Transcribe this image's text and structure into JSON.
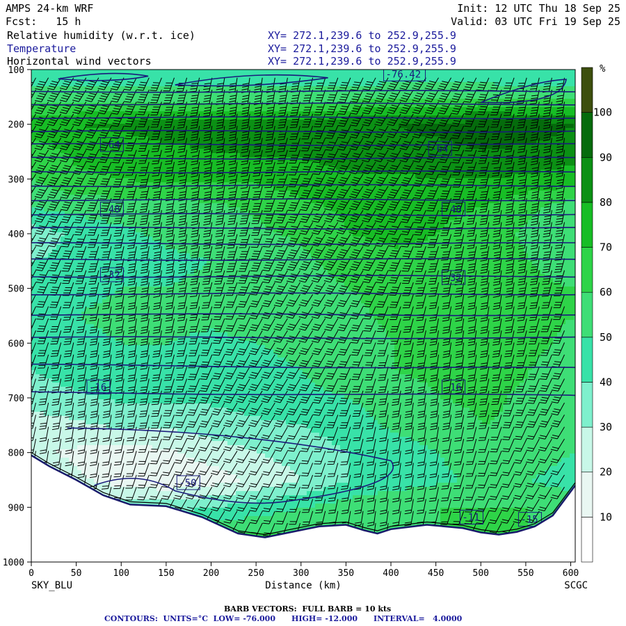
{
  "header": {
    "model": "AMPS 24-km WRF",
    "init": "Init: 12 UTC Thu 18 Sep 25",
    "fcst": "Fcst:   15 h",
    "valid": "Valid: 03 UTC Fri 19 Sep 25",
    "fields": [
      {
        "name": "Relative humidity (w.r.t. ice)",
        "xy": "XY= 272.1,239.6 to 252.9,255.9",
        "color": "#000000"
      },
      {
        "name": "Temperature",
        "xy": "XY= 272.1,239.6 to 252.9,255.9",
        "color": "#1a1a9c"
      },
      {
        "name": "Horizontal wind vectors",
        "xy": "XY= 272.1,239.6 to 252.9,255.9",
        "color": "#000000"
      }
    ]
  },
  "footer": {
    "barb": "BARB VECTORS:  FULL BARB = 10 kts",
    "contours": "CONTOURS:  UNITS=°C  LOW= -76.000      HIGH= -12.000      INTERVAL=   4.0000"
  },
  "chart_data": {
    "type": "heatmap",
    "xlabel": "Distance (km)",
    "x_endpoints": [
      "SKY_BLU",
      "SCGC"
    ],
    "x_ticks": [
      0,
      50,
      100,
      150,
      200,
      250,
      300,
      350,
      400,
      450,
      500,
      550,
      600
    ],
    "xlim": [
      0,
      605
    ],
    "y_ticks": [
      100,
      200,
      300,
      400,
      500,
      600,
      700,
      800,
      900,
      1000
    ],
    "ylim": [
      1000,
      100
    ],
    "colorbar": {
      "unit": "%",
      "ticks": [
        10,
        20,
        30,
        40,
        50,
        60,
        70,
        80,
        90,
        100
      ],
      "colors": [
        "#ffffff",
        "#e9f7f2",
        "#c8f8e8",
        "#7ef0cd",
        "#38e2a8",
        "#3ede76",
        "#2ed448",
        "#17bd25",
        "#0b9014",
        "#056b0c",
        "#3d4f0e"
      ]
    },
    "rh_pattern": {
      "rows": [
        {
          "p": 100,
          "vals": [
            40,
            40,
            40,
            40,
            40,
            40,
            40,
            40,
            40,
            40,
            40,
            40,
            40
          ]
        },
        {
          "p": 150,
          "vals": [
            55,
            55,
            55,
            55,
            55,
            55,
            55,
            55,
            60,
            60,
            60,
            55,
            55
          ]
        },
        {
          "p": 200,
          "vals": [
            75,
            80,
            82,
            85,
            85,
            85,
            85,
            88,
            90,
            92,
            94,
            96,
            90
          ]
        },
        {
          "p": 250,
          "vals": [
            65,
            72,
            75,
            78,
            80,
            82,
            82,
            85,
            88,
            88,
            90,
            88,
            85
          ]
        },
        {
          "p": 300,
          "vals": [
            60,
            68,
            70,
            72,
            72,
            72,
            75,
            78,
            78,
            80,
            80,
            78,
            75
          ]
        },
        {
          "p": 350,
          "vals": [
            50,
            55,
            55,
            55,
            58,
            62,
            68,
            72,
            75,
            72,
            70,
            62,
            55
          ]
        },
        {
          "p": 400,
          "vals": [
            35,
            42,
            48,
            52,
            55,
            58,
            62,
            70,
            72,
            70,
            65,
            58,
            50
          ]
        },
        {
          "p": 450,
          "vals": [
            40,
            42,
            45,
            48,
            50,
            55,
            58,
            65,
            68,
            68,
            65,
            60,
            55
          ]
        },
        {
          "p": 500,
          "vals": [
            45,
            48,
            50,
            50,
            52,
            55,
            55,
            60,
            62,
            65,
            65,
            62,
            60
          ]
        },
        {
          "p": 550,
          "vals": [
            48,
            50,
            52,
            52,
            52,
            55,
            55,
            58,
            62,
            65,
            65,
            62,
            60
          ]
        },
        {
          "p": 600,
          "vals": [
            45,
            48,
            50,
            50,
            48,
            50,
            52,
            55,
            60,
            65,
            65,
            62,
            58
          ]
        },
        {
          "p": 650,
          "vals": [
            40,
            45,
            45,
            45,
            45,
            48,
            50,
            55,
            60,
            62,
            65,
            60,
            55
          ]
        },
        {
          "p": 700,
          "vals": [
            35,
            38,
            42,
            42,
            42,
            45,
            48,
            50,
            55,
            60,
            62,
            58,
            55
          ]
        },
        {
          "p": 750,
          "vals": [
            25,
            28,
            32,
            32,
            35,
            38,
            40,
            45,
            52,
            55,
            60,
            58,
            55
          ]
        },
        {
          "p": 800,
          "vals": [
            22,
            18,
            15,
            18,
            25,
            30,
            35,
            40,
            45,
            50,
            58,
            55,
            50
          ]
        },
        {
          "p": 850,
          "vals": [
            30,
            22,
            15,
            12,
            15,
            22,
            30,
            40,
            45,
            48,
            52,
            50,
            45
          ]
        },
        {
          "p": 900,
          "vals": [
            45,
            40,
            35,
            35,
            40,
            45,
            50,
            55,
            58,
            60,
            60,
            60,
            55
          ]
        },
        {
          "p": 950,
          "vals": [
            60,
            60,
            60,
            60,
            60,
            60,
            60,
            60,
            60,
            60,
            60,
            60,
            60
          ]
        }
      ]
    },
    "terrain_p": [
      [
        0,
        805
      ],
      [
        20,
        825
      ],
      [
        50,
        850
      ],
      [
        80,
        878
      ],
      [
        110,
        895
      ],
      [
        150,
        898
      ],
      [
        190,
        918
      ],
      [
        230,
        948
      ],
      [
        260,
        955
      ],
      [
        290,
        945
      ],
      [
        320,
        935
      ],
      [
        350,
        932
      ],
      [
        370,
        942
      ],
      [
        385,
        948
      ],
      [
        400,
        940
      ],
      [
        420,
        936
      ],
      [
        440,
        932
      ],
      [
        460,
        935
      ],
      [
        480,
        938
      ],
      [
        500,
        946
      ],
      [
        520,
        950
      ],
      [
        540,
        945
      ],
      [
        560,
        935
      ],
      [
        580,
        915
      ],
      [
        605,
        860
      ]
    ],
    "temperature_contours": [
      {
        "p": 140,
        "label": ""
      },
      {
        "p": 163,
        "label": ""
      },
      {
        "p": 188,
        "label": ""
      },
      {
        "p": 213,
        "label": ""
      },
      {
        "p": 237,
        "label": "-64"
      },
      {
        "p": 262,
        "label": ""
      },
      {
        "p": 287,
        "label": ""
      },
      {
        "p": 312,
        "label": ""
      },
      {
        "p": 338,
        "label": ""
      },
      {
        "p": 365,
        "label": "-48"
      },
      {
        "p": 390,
        "label": ""
      },
      {
        "p": 418,
        "label": ""
      },
      {
        "p": 447,
        "label": ""
      },
      {
        "p": 478,
        "label": "-32"
      },
      {
        "p": 510,
        "label": ""
      },
      {
        "p": 548,
        "label": ""
      },
      {
        "p": 590,
        "label": ""
      },
      {
        "p": 640,
        "label": ""
      },
      {
        "p": 690,
        "label": "-16"
      }
    ],
    "contour_labels": [
      {
        "x": 80,
        "p": 237,
        "text": "-64"
      },
      {
        "x": 445,
        "p": 244,
        "text": "-64"
      },
      {
        "x": 80,
        "p": 355,
        "text": "-48"
      },
      {
        "x": 460,
        "p": 355,
        "text": "-48"
      },
      {
        "x": 80,
        "p": 475,
        "text": "-32"
      },
      {
        "x": 460,
        "p": 480,
        "text": "-32"
      },
      {
        "x": 65,
        "p": 680,
        "text": "-16"
      },
      {
        "x": 460,
        "p": 680,
        "text": "-16"
      },
      {
        "x": 75,
        "p": 898,
        "text": "-16"
      },
      {
        "x": 165,
        "p": 855,
        "text": "-50"
      },
      {
        "x": 480,
        "p": 918,
        "text": "-11"
      },
      {
        "x": 545,
        "p": 922,
        "text": "-15"
      },
      {
        "x": 395,
        "p": 108,
        "text": "-76.42"
      }
    ]
  }
}
